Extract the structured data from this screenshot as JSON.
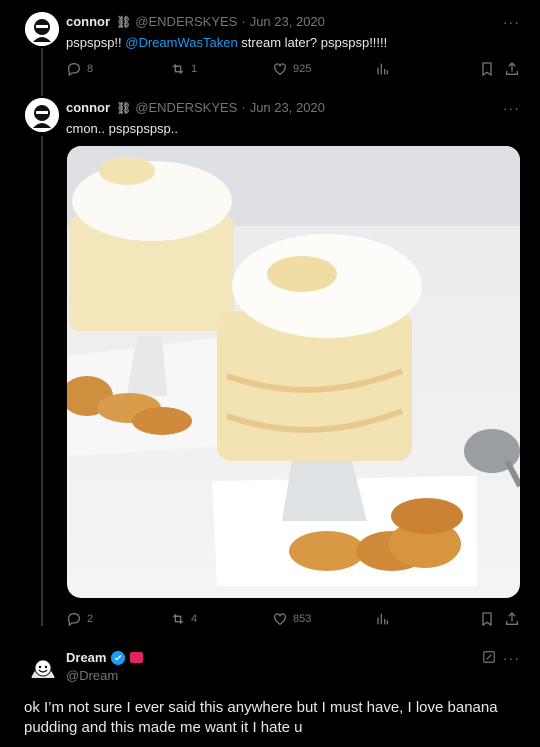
{
  "tweet1": {
    "name": "connor",
    "chain": "⛓",
    "handle": "@ENDERSKYES",
    "date": "Jun 23, 2020",
    "text_prefix": "pspspsp!! ",
    "mention": "@DreamWasTaken",
    "text_suffix": " stream later? pspspsp!!!!!",
    "replies": "8",
    "retweets": "1",
    "likes": "925"
  },
  "tweet2": {
    "name": "connor",
    "chain": "⛓",
    "handle": "@ENDERSKYES",
    "date": "Jun 23, 2020",
    "text": "cmon.. pspspspsp..",
    "replies": "2",
    "retweets": "4",
    "likes": "853"
  },
  "reply": {
    "name": "Dream",
    "handle": "@Dream",
    "text": "ok I’m not sure I ever said this anywhere but I must have, I love banana pudding and this made me want it I hate u"
  },
  "common": {
    "separator": "·",
    "more": "···"
  },
  "colors": {
    "accent": "#1d9bf0",
    "muted": "#71767b",
    "background": "#000000"
  },
  "icons": [
    "reply-icon",
    "retweet-icon",
    "like-icon",
    "views-icon",
    "bookmark-icon",
    "share-icon",
    "more-icon",
    "verified-icon",
    "edit-icon"
  ]
}
